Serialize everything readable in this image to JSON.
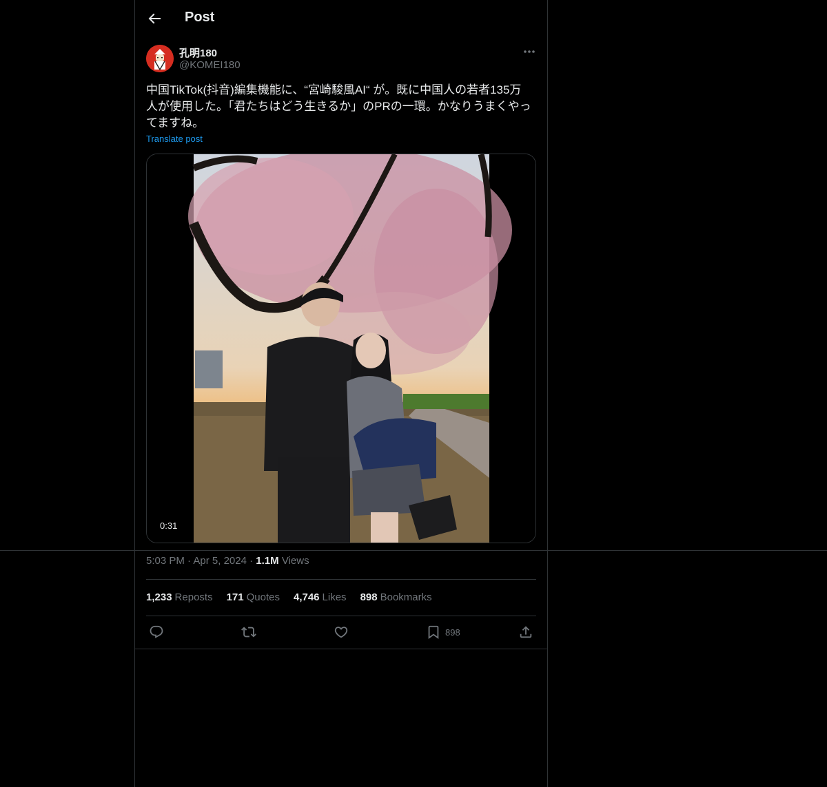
{
  "header": {
    "title": "Post",
    "back_icon": "arrow-left-icon"
  },
  "author": {
    "display_name": "孔明180",
    "handle": "@KOMEI180",
    "avatar_color": "#d62d20"
  },
  "post": {
    "text": "中国TikTok(抖音)編集機能に、“宮崎駿風AI“ が。既に中国人の若者135万\n人が使用した。「君たちはどう生きるか」のPRの一環。かなりうまくやっ\nてますね。",
    "translate_label": "Translate post",
    "video_duration": "0:31"
  },
  "meta": {
    "time": "5:03 PM",
    "sep": "·",
    "date": "Apr 5, 2024",
    "views_count": "1.1M",
    "views_label": "Views"
  },
  "stats": [
    {
      "count": "1,233",
      "label": "Reposts"
    },
    {
      "count": "171",
      "label": "Quotes"
    },
    {
      "count": "4,746",
      "label": "Likes"
    },
    {
      "count": "898",
      "label": "Bookmarks"
    }
  ],
  "actions": {
    "reply_icon": "reply-icon",
    "repost_icon": "repost-icon",
    "like_icon": "heart-icon",
    "bookmark_icon": "bookmark-icon",
    "bookmark_count": "898",
    "share_icon": "share-icon"
  },
  "colors": {
    "accent": "#1d9bf0",
    "muted": "#71767b",
    "border": "#2f3336",
    "background": "#000000"
  }
}
